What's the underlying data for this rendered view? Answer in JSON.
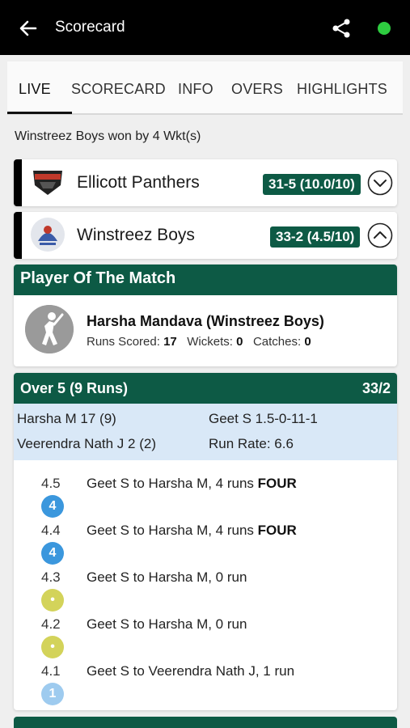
{
  "topbar": {
    "title": "Scorecard"
  },
  "tabs": [
    {
      "label": "LIVE"
    },
    {
      "label": "SCORECARD"
    },
    {
      "label": "INFO"
    },
    {
      "label": "OVERS"
    },
    {
      "label": "HIGHLIGHTS"
    }
  ],
  "result": "Winstreez Boys won by 4 Wkt(s)",
  "teams": [
    {
      "name": "Ellicott Panthers",
      "score": "31-5 (10.0/10)",
      "expanded": false
    },
    {
      "name": "Winstreez Boys",
      "score": "33-2 (4.5/10)",
      "expanded": true
    }
  ],
  "potm": {
    "header": "Player Of The Match",
    "name": "Harsha Mandava (Winstreez Boys)",
    "runs_label": "Runs Scored:",
    "runs": "17",
    "wickets_label": "Wickets:",
    "wickets": "0",
    "catches_label": "Catches:",
    "catches": "0"
  },
  "over": {
    "title": "Over 5 (9 Runs)",
    "total": "33/2",
    "batsman1": "Harsha M 17 (9)",
    "batsman2": "Veerendra Nath J 2 (2)",
    "bowler": "Geet S 1.5-0-11-1",
    "run_rate": "Run Rate: 6.6",
    "balls": [
      {
        "num": "4.5",
        "badge": "4",
        "text": "Geet S to Harsha M, 4 runs ",
        "highlight": "FOUR",
        "color": "#3b97dd"
      },
      {
        "num": "4.4",
        "badge": "4",
        "text": "Geet S to Harsha M, 4 runs ",
        "highlight": "FOUR",
        "color": "#3b97dd"
      },
      {
        "num": "4.3",
        "badge": "•",
        "text": "Geet S to Harsha M, 0 run",
        "highlight": "",
        "color": "#d3d35a"
      },
      {
        "num": "4.2",
        "badge": "•",
        "text": "Geet S to Harsha M, 0 run",
        "highlight": "",
        "color": "#d3d35a"
      },
      {
        "num": "4.1",
        "badge": "1",
        "text": "Geet S to Veerendra Nath J, 1 run",
        "highlight": "",
        "color": "#9ecbef"
      }
    ]
  },
  "colors": {
    "primary": "#0d5a45",
    "summary_bg": "#d9e8f7",
    "status_dot": "#2ecc40"
  }
}
